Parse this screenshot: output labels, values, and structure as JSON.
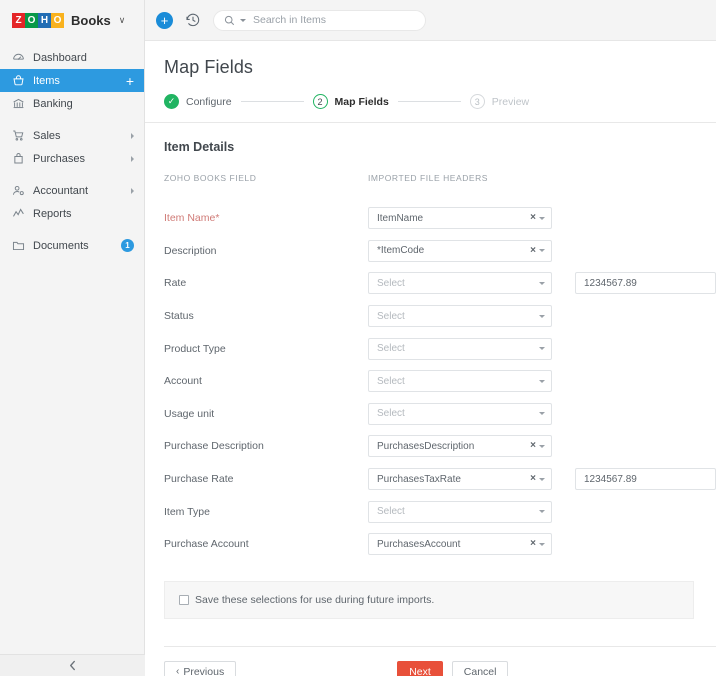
{
  "sidebar": {
    "brand": {
      "logo_letters": [
        "Z",
        "O",
        "H",
        "O"
      ],
      "name": "Books",
      "caret": "∨"
    },
    "items": [
      {
        "label": "Dashboard",
        "icon": "dashboard-icon",
        "type": "plain"
      },
      {
        "label": "Items",
        "icon": "items-basket-icon",
        "type": "active",
        "action": "+"
      },
      {
        "label": "Banking",
        "icon": "bank-icon",
        "type": "plain"
      },
      {
        "label": "Sales",
        "icon": "sales-cart-icon",
        "type": "expandable"
      },
      {
        "label": "Purchases",
        "icon": "purchases-bag-icon",
        "type": "expandable"
      },
      {
        "label": "Accountant",
        "icon": "accountant-icon",
        "type": "expandable"
      },
      {
        "label": "Reports",
        "icon": "reports-chart-icon",
        "type": "plain"
      },
      {
        "label": "Documents",
        "icon": "documents-folder-icon",
        "type": "badge",
        "badge": "1"
      }
    ],
    "collapse_label": "‹"
  },
  "topbar": {
    "add_label": "+",
    "clock_icon": "recent-history-icon",
    "search": {
      "placeholder": "Search in Items",
      "value": ""
    }
  },
  "page": {
    "title": "Map Fields"
  },
  "stepper": {
    "steps": [
      {
        "num": "✓",
        "label": "Configure",
        "state": "done"
      },
      {
        "num": "2",
        "label": "Map Fields",
        "state": "current"
      },
      {
        "num": "3",
        "label": "Preview",
        "state": "todo"
      }
    ]
  },
  "form": {
    "section_title": "Item Details",
    "column_headers": {
      "left": "ZOHO BOOKS FIELD",
      "right": "IMPORTED FILE HEADERS"
    },
    "rows": [
      {
        "label": "Item Name*",
        "required": true,
        "value": "ItemName",
        "placeholder": false,
        "clearable": true,
        "preview": null
      },
      {
        "label": "Description",
        "required": false,
        "value": "*ItemCode",
        "placeholder": false,
        "clearable": true,
        "preview": null
      },
      {
        "label": "Rate",
        "required": false,
        "value": "Select",
        "placeholder": true,
        "clearable": false,
        "preview": "1234567.89"
      },
      {
        "label": "Status",
        "required": false,
        "value": "Select",
        "placeholder": true,
        "clearable": false,
        "preview": null
      },
      {
        "label": "Product Type",
        "required": false,
        "value": "Select",
        "placeholder": true,
        "clearable": false,
        "preview": null
      },
      {
        "label": "Account",
        "required": false,
        "value": "Select",
        "placeholder": true,
        "clearable": false,
        "preview": null
      },
      {
        "label": "Usage unit",
        "required": false,
        "value": "Select",
        "placeholder": true,
        "clearable": false,
        "preview": null
      },
      {
        "label": "Purchase Description",
        "required": false,
        "value": "PurchasesDescription",
        "placeholder": false,
        "clearable": true,
        "preview": null
      },
      {
        "label": "Purchase Rate",
        "required": false,
        "value": "PurchasesTaxRate",
        "placeholder": false,
        "clearable": true,
        "preview": "1234567.89"
      },
      {
        "label": "Item Type",
        "required": false,
        "value": "Select",
        "placeholder": true,
        "clearable": false,
        "preview": null
      },
      {
        "label": "Purchase Account",
        "required": false,
        "value": "PurchasesAccount",
        "placeholder": false,
        "clearable": true,
        "preview": null
      }
    ],
    "save_selection": {
      "label": "Save these selections for use during future imports.",
      "checked": false
    }
  },
  "footer": {
    "previous_label": "Previous",
    "next_label": "Next",
    "cancel_label": "Cancel"
  },
  "colors": {
    "sidebar_active": "#2d9ae0",
    "step_done": "#21b462",
    "primary_button": "#e8503a",
    "required_label": "#d07b77"
  }
}
